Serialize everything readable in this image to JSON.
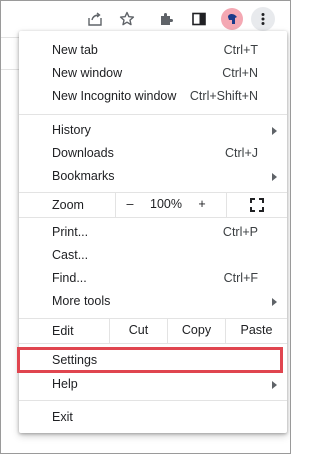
{
  "colors": {
    "highlight": "#e0454f",
    "avatar_bg": "#f4a8b3",
    "avatar_fg": "#1a3a8a",
    "separator": "#e3e3e3",
    "toolbar_active_bg": "#e8eaed"
  },
  "toolbar": {
    "icons": [
      "share-icon",
      "star-icon",
      "extensions-icon",
      "side-panel-icon",
      "profile-avatar-icon",
      "more-menu-icon"
    ]
  },
  "menu": {
    "new_tab": {
      "label": "New tab",
      "shortcut": "Ctrl+T"
    },
    "new_window": {
      "label": "New window",
      "shortcut": "Ctrl+N"
    },
    "new_incognito": {
      "label": "New Incognito window",
      "shortcut": "Ctrl+Shift+N"
    },
    "history": {
      "label": "History"
    },
    "downloads": {
      "label": "Downloads",
      "shortcut": "Ctrl+J"
    },
    "bookmarks": {
      "label": "Bookmarks"
    },
    "zoom": {
      "label": "Zoom",
      "minus": "–",
      "value": "100%",
      "plus": "+"
    },
    "print": {
      "label": "Print...",
      "shortcut": "Ctrl+P"
    },
    "cast": {
      "label": "Cast..."
    },
    "find": {
      "label": "Find...",
      "shortcut": "Ctrl+F"
    },
    "more_tools": {
      "label": "More tools"
    },
    "edit": {
      "label": "Edit",
      "cut": "Cut",
      "copy": "Copy",
      "paste": "Paste"
    },
    "settings": {
      "label": "Settings"
    },
    "help": {
      "label": "Help"
    },
    "exit": {
      "label": "Exit"
    }
  }
}
